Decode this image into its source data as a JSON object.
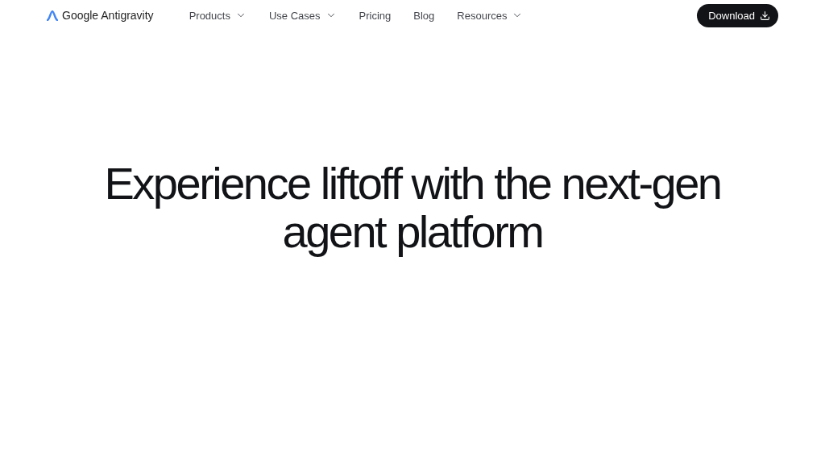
{
  "brand": {
    "name": "Google Antigravity"
  },
  "nav": [
    {
      "label": "Products",
      "kind": "dropdown"
    },
    {
      "label": "Use Cases",
      "kind": "dropdown"
    },
    {
      "label": "Pricing",
      "kind": "link"
    },
    {
      "label": "Blog",
      "kind": "link"
    },
    {
      "label": "Resources",
      "kind": "dropdown"
    }
  ],
  "cta": {
    "label": "Download"
  },
  "hero": {
    "headline": "Experience liftoff with the next-gen agent platform"
  }
}
